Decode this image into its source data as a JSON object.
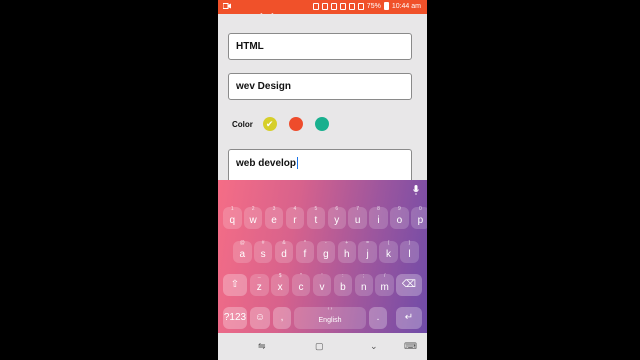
{
  "status": {
    "time": "10:44 am",
    "battery": "75%",
    "dots": "• •"
  },
  "form": {
    "field1_value": "HTML",
    "field2_value": "wev Design",
    "color_label": "Color",
    "colors": [
      "#d6cf2a",
      "#ee4c2c",
      "#19b08e"
    ],
    "selected_color_index": 0,
    "field3_value": "web develop"
  },
  "keyboard": {
    "row1": [
      {
        "k": "q",
        "h": "1"
      },
      {
        "k": "w",
        "h": "2"
      },
      {
        "k": "e",
        "h": "3"
      },
      {
        "k": "r",
        "h": "4"
      },
      {
        "k": "t",
        "h": "5"
      },
      {
        "k": "y",
        "h": "6"
      },
      {
        "k": "u",
        "h": "7"
      },
      {
        "k": "i",
        "h": "8"
      },
      {
        "k": "o",
        "h": "9"
      },
      {
        "k": "p",
        "h": "0"
      }
    ],
    "row2": [
      {
        "k": "a",
        "h": "@"
      },
      {
        "k": "s",
        "h": "#"
      },
      {
        "k": "d",
        "h": "&"
      },
      {
        "k": "f",
        "h": "*"
      },
      {
        "k": "g",
        "h": "-"
      },
      {
        "k": "h",
        "h": "+"
      },
      {
        "k": "j",
        "h": "="
      },
      {
        "k": "k",
        "h": "("
      },
      {
        "k": "l",
        "h": ")"
      }
    ],
    "row3": [
      {
        "k": "z",
        "h": "_"
      },
      {
        "k": "x",
        "h": "$"
      },
      {
        "k": "c",
        "h": "\""
      },
      {
        "k": "v",
        "h": "'"
      },
      {
        "k": "b",
        "h": ":"
      },
      {
        "k": "n",
        "h": ";"
      },
      {
        "k": "m",
        "h": "/"
      }
    ],
    "shift_label": "⇧",
    "backspace_label": "⌫",
    "symbols_label": "?123",
    "emoji_label": "☺",
    "comma_label": ",",
    "space_label": "English",
    "space_hint_left": "‹",
    "space_hint_right": "›",
    "period_label": ".",
    "enter_label": "↵",
    "mic_icon": "microphone-icon"
  },
  "navbar": {
    "recent_icon": "recent-apps-icon",
    "home_icon": "home-icon",
    "back_icon": "back-icon",
    "keyboard_icon": "keyboard-hide-icon"
  }
}
